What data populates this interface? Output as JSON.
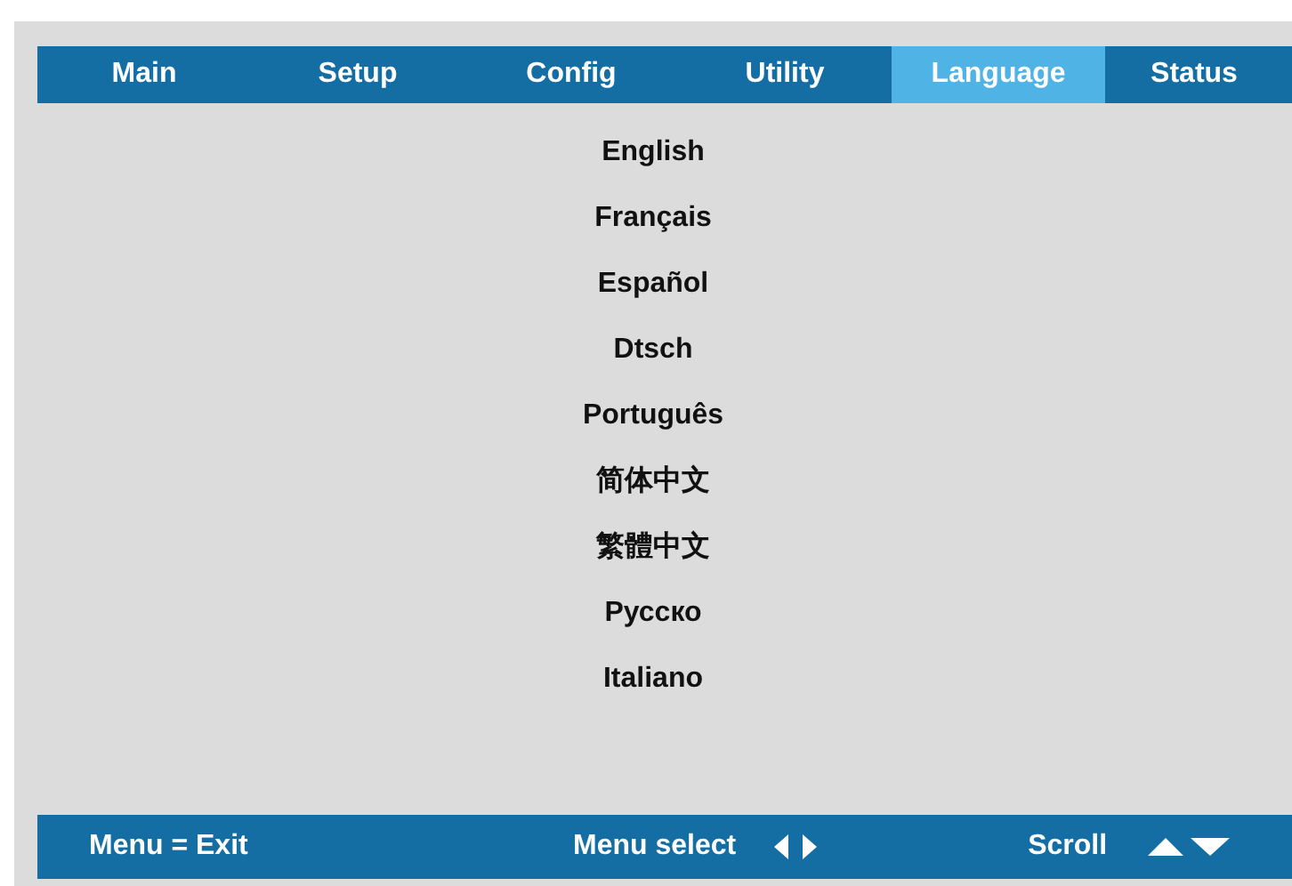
{
  "tabs": [
    {
      "label": "Main",
      "selected": false
    },
    {
      "label": "Setup",
      "selected": false
    },
    {
      "label": "Config",
      "selected": false
    },
    {
      "label": "Utility",
      "selected": false
    },
    {
      "label": "Language",
      "selected": true
    },
    {
      "label": "Status",
      "selected": false
    }
  ],
  "languages": [
    "English",
    "Français",
    "Español",
    "Dtsch",
    "Português",
    "简体中文",
    "繁體中文",
    "Русско",
    "Italiano"
  ],
  "footer": {
    "exit_hint": "Menu = Exit",
    "select_hint": "Menu select",
    "scroll_hint": "Scroll"
  }
}
